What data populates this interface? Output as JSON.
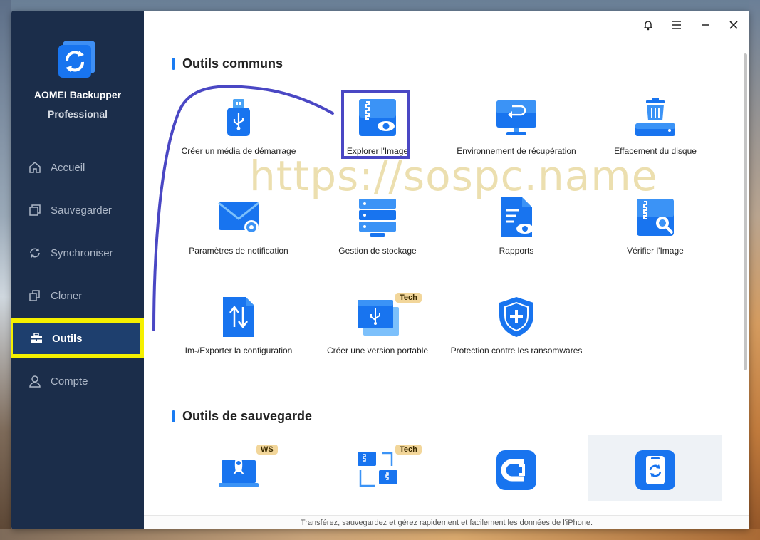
{
  "window": {
    "app_name": "AOMEI Backupper",
    "edition": "Professional"
  },
  "sidebar": {
    "items": [
      {
        "label": "Accueil",
        "icon": "home-icon"
      },
      {
        "label": "Sauvegarder",
        "icon": "backup-icon"
      },
      {
        "label": "Synchroniser",
        "icon": "sync-icon"
      },
      {
        "label": "Cloner",
        "icon": "clone-icon"
      },
      {
        "label": "Outils",
        "icon": "toolbox-icon",
        "active": true
      },
      {
        "label": "Compte",
        "icon": "user-icon"
      }
    ]
  },
  "titlebar": {
    "buttons": [
      "bell-icon",
      "menu-icon",
      "minimize-icon",
      "close-icon"
    ]
  },
  "sections": {
    "common": {
      "title": "Outils communs",
      "tools": [
        {
          "label": "Créer un média de démarrage",
          "icon": "usb-drive-icon"
        },
        {
          "label": "Explorer l'Image",
          "icon": "image-explore-icon"
        },
        {
          "label": "Environnement de récupération",
          "icon": "recovery-monitor-icon"
        },
        {
          "label": "Effacement du disque",
          "icon": "disk-wipe-icon"
        },
        {
          "label": "Paramètres de notification",
          "icon": "mail-settings-icon"
        },
        {
          "label": "Gestion de stockage",
          "icon": "storage-server-icon"
        },
        {
          "label": "Rapports",
          "icon": "report-icon"
        },
        {
          "label": "Vérifier l'Image",
          "icon": "image-check-icon"
        },
        {
          "label": "Im-/Exporter la configuration",
          "icon": "import-export-icon"
        },
        {
          "label": "Créer une version portable",
          "icon": "portable-version-icon",
          "badge": "Tech"
        },
        {
          "label": "Protection contre les ransomwares",
          "icon": "shield-plus-icon"
        }
      ]
    },
    "backup": {
      "title": "Outils de sauvegarde",
      "tools": [
        {
          "icon": "rocket-laptop-icon",
          "badge": "WS"
        },
        {
          "icon": "network-backup-icon",
          "badge": "Tech"
        },
        {
          "icon": "cbackup-icon"
        },
        {
          "icon": "iphone-backup-icon"
        }
      ]
    }
  },
  "footer": {
    "tooltip": "Transférez, sauvegardez et gérez rapidement et facilement les données de l'iPhone."
  },
  "watermark": "https://sospc.name",
  "colors": {
    "sidebar_bg": "#1b2d4a",
    "accent": "#1a7cf2",
    "highlight_yellow": "#f5f000",
    "annotation_blue": "#4a47c4"
  }
}
